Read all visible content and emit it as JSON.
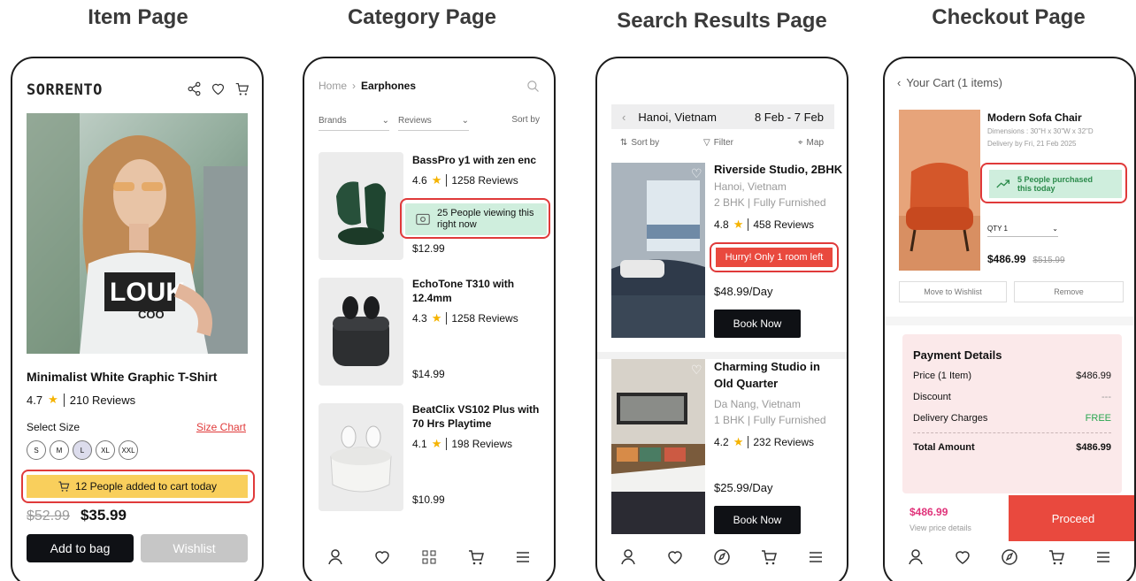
{
  "titles": {
    "item": "Item Page",
    "category": "Category Page",
    "search": "Search Results Page",
    "checkout": "Checkout Page"
  },
  "item": {
    "brand": "SORRENTO",
    "product_name": "Minimalist White Graphic T-Shirt",
    "rating": "4.7",
    "reviews": "210 Reviews",
    "select_size": "Select Size",
    "size_chart": "Size Chart",
    "sizes": [
      "S",
      "M",
      "L",
      "XL",
      "XXL"
    ],
    "selected_size": "L",
    "urgency": "12 People added to cart today",
    "old_price": "$52.99",
    "price": "$35.99",
    "add_to_bag": "Add to bag",
    "wishlist": "Wishlist",
    "shirt_text_1": "LOUK",
    "shirt_text_2": "COO"
  },
  "category": {
    "breadcrumb_home": "Home",
    "breadcrumb_current": "Earphones",
    "filter_brands": "Brands",
    "filter_reviews": "Reviews",
    "sort_by": "Sort by",
    "products": [
      {
        "name": "BassPro y1 with zen enc",
        "rating": "4.6",
        "reviews": "1258 Reviews",
        "price": "$12.99"
      },
      {
        "name": "EchoTone T310 with 12.4mm",
        "rating": "4.3",
        "reviews": "1258 Reviews",
        "price": "$14.99"
      },
      {
        "name": "BeatClix VS102 Plus with 70 Hrs Playtime",
        "rating": "4.1",
        "reviews": "198 Reviews",
        "price": "$10.99"
      }
    ],
    "viewing_badge": "25 People viewing this right now"
  },
  "search": {
    "location": "Hanoi, Vietnam",
    "dates": "8 Feb - 7 Feb",
    "sort_by": "Sort by",
    "filter": "Filter",
    "map": "Map",
    "results": [
      {
        "title": "Riverside Studio, 2BHK",
        "location": "Hanoi, Vietnam",
        "type": "2 BHK | Fully Furnished",
        "rating": "4.8",
        "reviews": "458 Reviews",
        "price": "$48.99/Day",
        "cta": "Book Now"
      },
      {
        "title": "Charming Studio in Old Quarter",
        "location": "Da Nang, Vietnam",
        "type": "1 BHK | Fully Furnished",
        "rating": "4.2",
        "reviews": "232 Reviews",
        "price": "$25.99/Day",
        "cta": "Book Now"
      }
    ],
    "urgency": "Hurry! Only 1 room left"
  },
  "checkout": {
    "header": "Your Cart (1 items)",
    "product_name": "Modern Sofa Chair",
    "dimensions": "Dimensions : 30\"H x 30\"W x 32\"D",
    "delivery": "Delivery by Fri, 21 Feb 2025",
    "purchased_badge": "5 People purchased this today",
    "qty": "QTY 1",
    "price": "$486.99",
    "old_price": "$515.99",
    "move_to_wishlist": "Move to Wishlist",
    "remove": "Remove",
    "payment_title": "Payment Details",
    "rows": [
      {
        "label": "Price (1 Item)",
        "value": "$486.99"
      },
      {
        "label": "Discount",
        "value": "---"
      },
      {
        "label": "Delivery Charges",
        "value": "FREE"
      },
      {
        "label": "Total Amount",
        "value": "$486.99"
      }
    ],
    "footer_price": "$486.99",
    "view_details": "View price details",
    "proceed": "Proceed"
  },
  "colors": {
    "urgency_yellow": "#f9cf5c",
    "urgency_green": "#cfeedd",
    "urgency_red": "#e9493e",
    "annotation_red": "#e03a3a",
    "proceed": "#e9493e",
    "price_pink": "#e0337a",
    "free_green": "#2aa650"
  },
  "icons": [
    "share-icon",
    "heart-icon",
    "cart-icon",
    "search-icon",
    "filter-icon",
    "map-pin-icon",
    "trend-up-icon",
    "eye-icon",
    "user-icon",
    "grid-icon",
    "compass-icon",
    "menu-icon",
    "chevron-left-icon",
    "chevron-down-icon",
    "sort-icon"
  ]
}
